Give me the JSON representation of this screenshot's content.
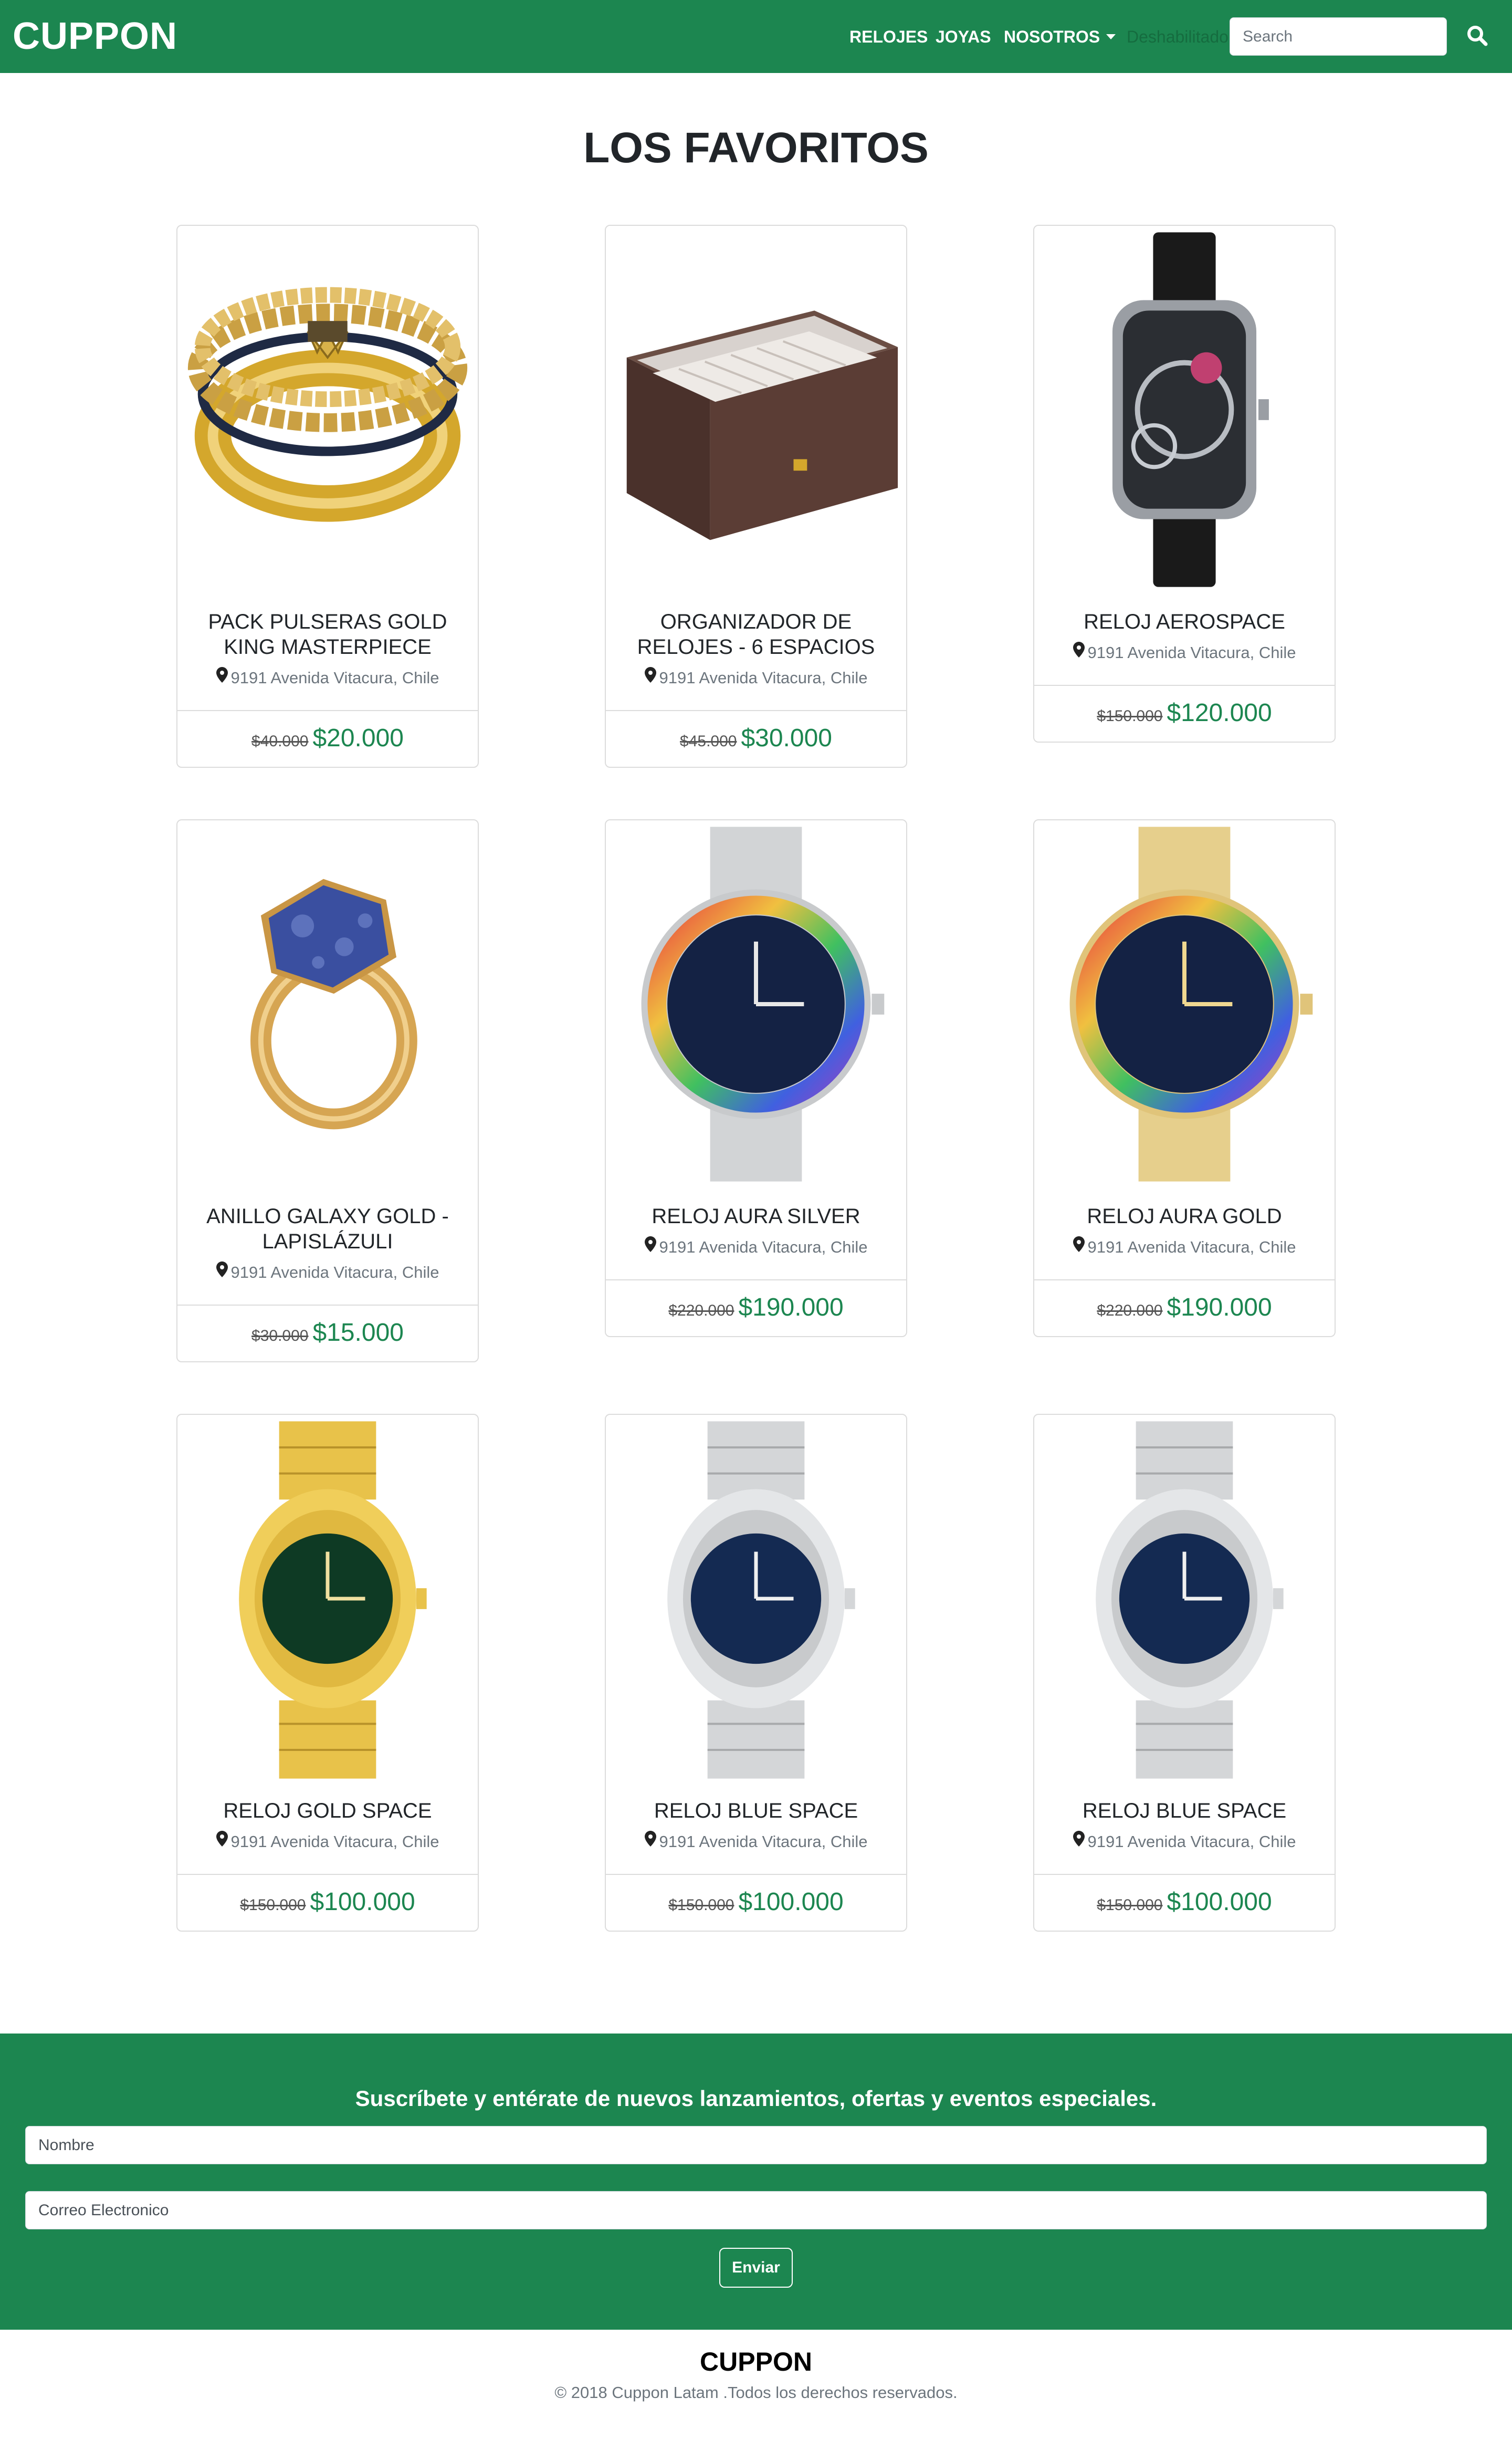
{
  "navbar": {
    "brand": "CUPPON",
    "links": [
      "RELOJES",
      "JOYAS",
      "NOSOTROS"
    ],
    "disabled_link": "Deshabilitado",
    "search_placeholder": "Search"
  },
  "section_title": "LOS FAVORITOS",
  "products": [
    {
      "title": "PACK PULSERAS GOLD KING MASTERPIECE",
      "location": "9191 Avenida Vitacura, Chile",
      "old_price": "$40.000",
      "price": "$20.000",
      "image": "gold-bracelets-image"
    },
    {
      "title": "ORGANIZADOR DE RELOJES - 6 ESPACIOS",
      "location": "9191 Avenida Vitacura, Chile",
      "old_price": "$45.000",
      "price": "$30.000",
      "image": "watch-box-image"
    },
    {
      "title": "RELOJ AEROSPACE",
      "location": "9191 Avenida Vitacura, Chile",
      "old_price": "$150.000",
      "price": "$120.000",
      "image": "skeleton-watch-image"
    },
    {
      "title": "ANILLO GALAXY GOLD - LAPISLÁZULI",
      "location": "9191 Avenida Vitacura, Chile",
      "old_price": "$30.000",
      "price": "$15.000",
      "image": "lapis-ring-image"
    },
    {
      "title": "RELOJ AURA SILVER",
      "location": "9191 Avenida Vitacura, Chile",
      "old_price": "$220.000",
      "price": "$190.000",
      "image": "aura-silver-watch-image"
    },
    {
      "title": "RELOJ AURA GOLD",
      "location": "9191 Avenida Vitacura, Chile",
      "old_price": "$220.000",
      "price": "$190.000",
      "image": "aura-gold-watch-image"
    },
    {
      "title": "RELOJ GOLD SPACE",
      "location": "9191 Avenida Vitacura, Chile",
      "old_price": "$150.000",
      "price": "$100.000",
      "image": "gold-space-watch-image"
    },
    {
      "title": "RELOJ BLUE SPACE",
      "location": "9191 Avenida Vitacura, Chile",
      "old_price": "$150.000",
      "price": "$100.000",
      "image": "blue-space-watch-image"
    },
    {
      "title": "RELOJ BLUE SPACE",
      "location": "9191 Avenida Vitacura, Chile",
      "old_price": "$150.000",
      "price": "$100.000",
      "image": "blue-space-watch-image"
    }
  ],
  "newsletter": {
    "title": "Suscríbete y entérate de nuevos lanzamientos, ofertas y eventos especiales.",
    "name_placeholder": "Nombre",
    "email_placeholder": "Correo Electronico",
    "submit_label": "Enviar"
  },
  "footer": {
    "brand": "CUPPON",
    "copyright": "© 2018 Cuppon Latam .Todos los derechos reservados."
  },
  "colors": {
    "brand_green": "#1c8650",
    "price_green": "#1c8650",
    "card_border": "#dcdcdc"
  }
}
